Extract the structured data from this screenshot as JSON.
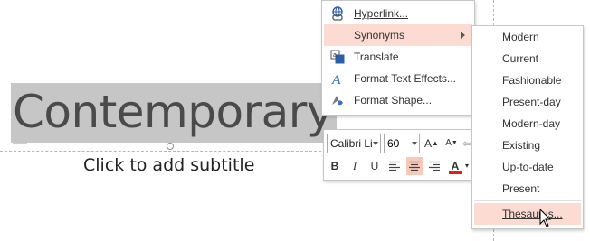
{
  "slide": {
    "title": "Contemporary",
    "subtitle": "Click to add subtitle"
  },
  "context_menu": {
    "items": [
      {
        "label": "Hyperlink...",
        "icon": "hyperlink-icon"
      },
      {
        "label": "Synonyms",
        "icon": "",
        "has_submenu": true,
        "highlighted": true
      },
      {
        "label": "Translate",
        "icon": "translate-icon"
      },
      {
        "label": "Format Text Effects...",
        "icon": "text-effects-icon"
      },
      {
        "label": "Format Shape...",
        "icon": "format-shape-icon"
      }
    ]
  },
  "mini_toolbar": {
    "font_name": "Calibri Li",
    "font_size": "60",
    "grow_font": "A",
    "shrink_font": "A",
    "bold": "B",
    "italic": "I",
    "underline": "U",
    "font_color_label": "A",
    "font_color": "#e02020"
  },
  "synonyms_submenu": {
    "items": [
      {
        "label": "Modern"
      },
      {
        "label": "Current"
      },
      {
        "label": "Fashionable"
      },
      {
        "label": "Present-day"
      },
      {
        "label": "Modern-day"
      },
      {
        "label": "Existing"
      },
      {
        "label": "Up-to-date"
      },
      {
        "label": "Present"
      },
      {
        "label": "Thesaurus...",
        "highlighted": true
      }
    ]
  },
  "colors": {
    "highlight": "#fcdcd2",
    "selection": "#c6c6c6",
    "accent": "#3b6fc4"
  }
}
